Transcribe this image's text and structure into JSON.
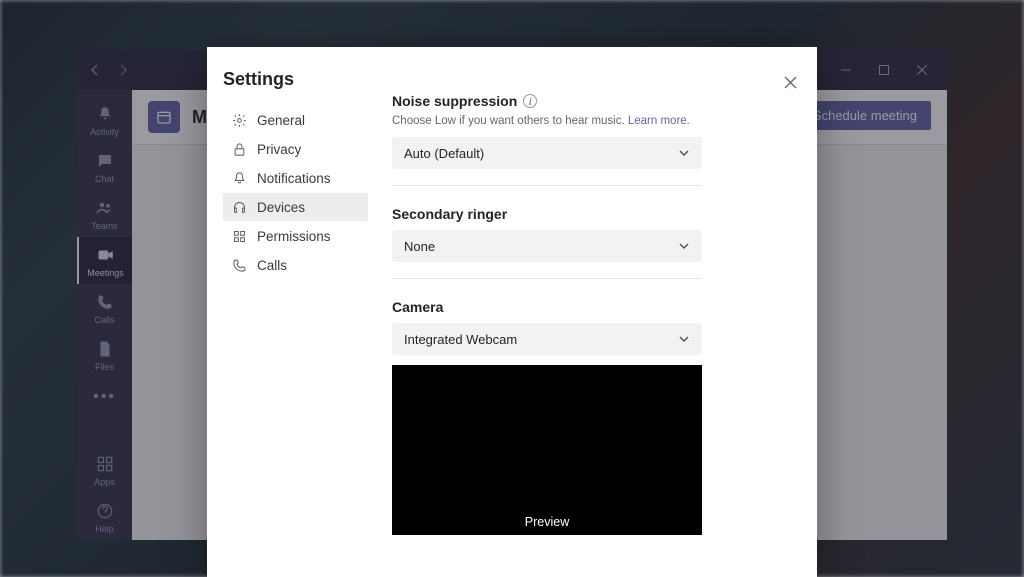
{
  "titlebar": {
    "window_buttons": {
      "min": "minimize",
      "max": "maximize",
      "close": "close"
    }
  },
  "leftrail": {
    "items": [
      {
        "key": "activity",
        "label": "Activity",
        "icon": "bell"
      },
      {
        "key": "chat",
        "label": "Chat",
        "icon": "chat"
      },
      {
        "key": "teams",
        "label": "Teams",
        "icon": "people"
      },
      {
        "key": "meetings",
        "label": "Meetings",
        "icon": "video"
      },
      {
        "key": "calls",
        "label": "Calls",
        "icon": "phone"
      },
      {
        "key": "files",
        "label": "Files",
        "icon": "file"
      }
    ],
    "bottom": [
      {
        "key": "apps",
        "label": "Apps",
        "icon": "grid"
      },
      {
        "key": "help",
        "label": "Help",
        "icon": "help"
      }
    ],
    "active_key": "meetings"
  },
  "header": {
    "title_initial": "M",
    "schedule_button": "Schedule meeting"
  },
  "modal": {
    "title": "Settings",
    "nav": [
      {
        "key": "general",
        "label": "General"
      },
      {
        "key": "privacy",
        "label": "Privacy"
      },
      {
        "key": "notifications",
        "label": "Notifications"
      },
      {
        "key": "devices",
        "label": "Devices"
      },
      {
        "key": "permissions",
        "label": "Permissions"
      },
      {
        "key": "calls",
        "label": "Calls"
      }
    ],
    "active_key": "devices",
    "sections": {
      "noise": {
        "title": "Noise suppression",
        "subtitle_pre": "Choose Low if you want others to hear music. ",
        "subtitle_link": "Learn more.",
        "value": "Auto (Default)"
      },
      "ringer": {
        "title": "Secondary ringer",
        "value": "None"
      },
      "camera": {
        "title": "Camera",
        "value": "Integrated Webcam",
        "preview_label": "Preview"
      }
    }
  }
}
